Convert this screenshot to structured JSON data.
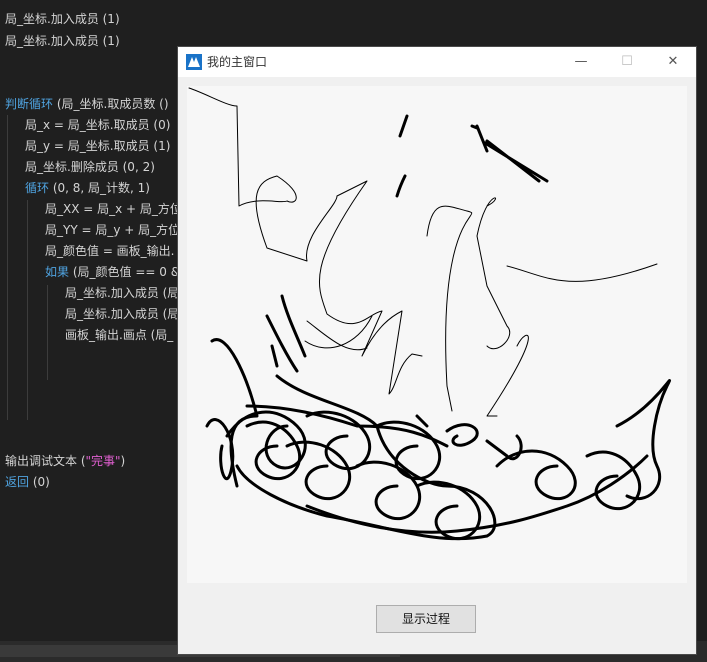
{
  "editor": {
    "lines": [
      {
        "text": "局_坐标.加入成员 (1)"
      },
      {
        "text": "局_坐标.加入成员 (1)"
      },
      {
        "kw": "判断循环",
        "text": " (局_坐标.取成员数 ()"
      },
      {
        "text": "局_x = 局_坐标.取成员 (0)"
      },
      {
        "text": "局_y = 局_坐标.取成员 (1)"
      },
      {
        "text": "局_坐标.删除成员 (0, 2)"
      },
      {
        "kw": "循环",
        "text": " (0, 8, 局_计数, 1)"
      },
      {
        "text": "局_XX = 局_x + 局_方位"
      },
      {
        "text": "局_YY = 局_y + 局_方位"
      },
      {
        "text": "局_颜色值 = 画板_输出."
      },
      {
        "kw": "如果",
        "text": " (局_颜色值 == 0 &"
      },
      {
        "text": "局_坐标.加入成员 (局"
      },
      {
        "text": "局_坐标.加入成员 (局"
      },
      {
        "text": "画板_输出.画点 (局_"
      },
      {
        "text": "输出调试文本 (",
        "str": "\"完事\"",
        "tail": ")"
      },
      {
        "kw": "返回",
        "text": " (0)"
      }
    ]
  },
  "window": {
    "title": "我的主窗口",
    "minimize": "—",
    "maximize": "☐",
    "close": "✕",
    "button_label": "显示过程"
  },
  "colors": {
    "editor_bg": "#1f1f1f",
    "keyword": "#4fa3e0",
    "string": "#e05fd0",
    "window_bg": "#f0f0f0",
    "canvas_bg": "#f7f7f7"
  }
}
